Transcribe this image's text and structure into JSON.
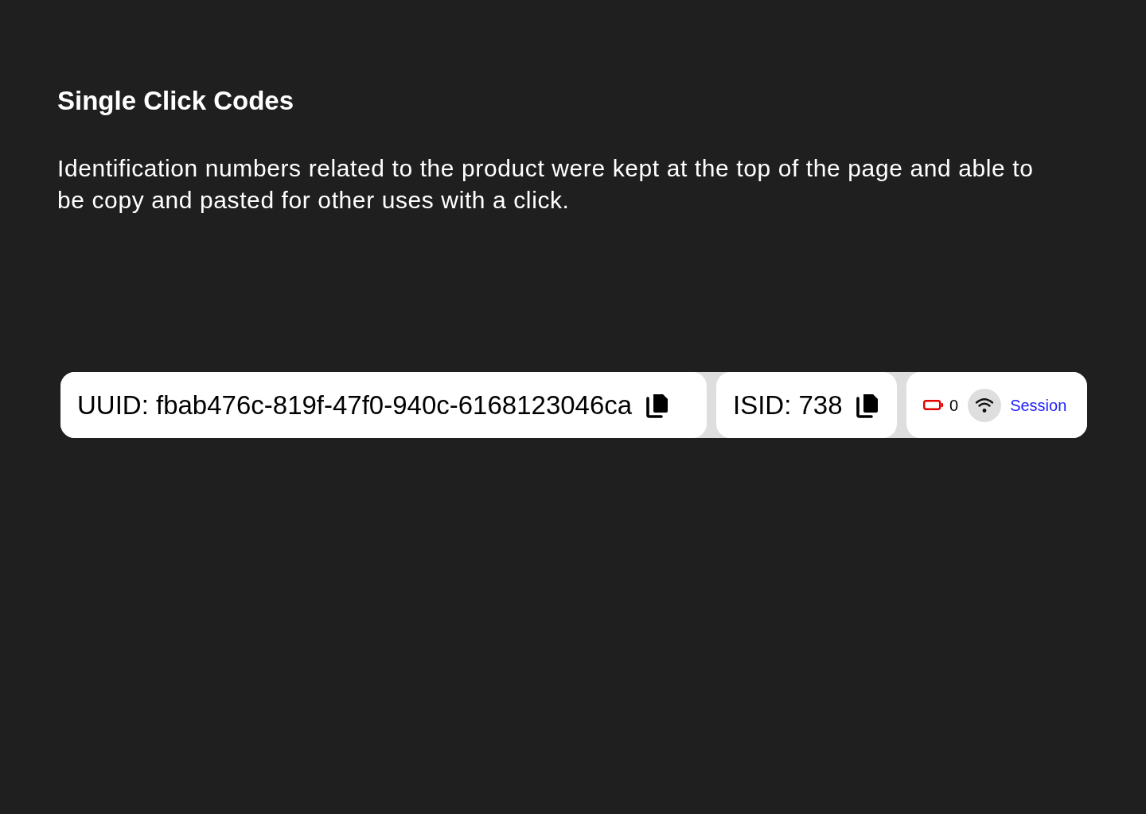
{
  "heading": "Single Click Codes",
  "description": "Identification numbers related to the product were kept at the top of the page and able to be copy and pasted for other uses with a click.",
  "codes": [
    {
      "text": "UUID: fbab476c-819f-47f0-940c-6168123046ca"
    },
    {
      "text": "ISID: 738"
    }
  ],
  "status": {
    "battery_reading": "0",
    "session_link": "Session"
  }
}
